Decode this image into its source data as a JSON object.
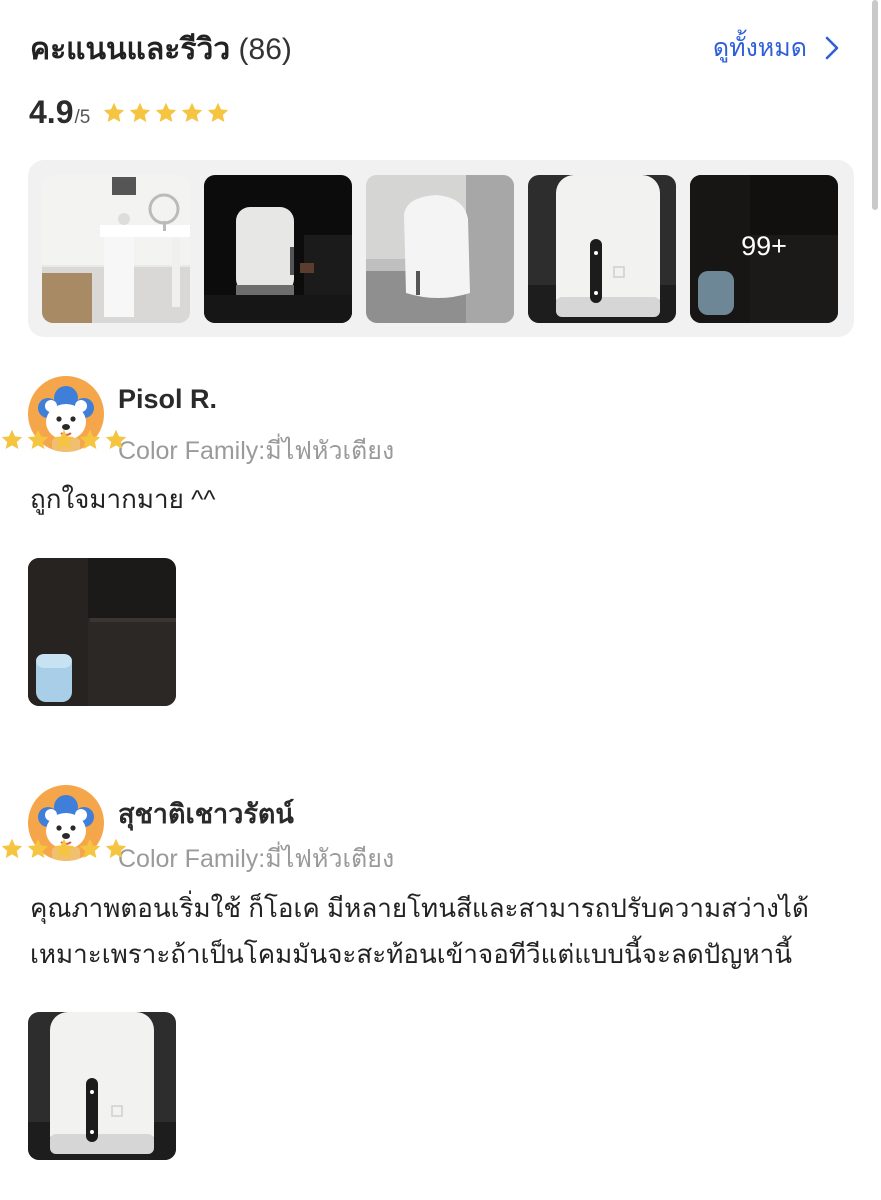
{
  "header": {
    "title": "คะแนนและรีวิว",
    "count": "(86)",
    "view_all_label": "ดูทั้งหมด"
  },
  "rating": {
    "value": "4.9",
    "max": "/5",
    "stars": 5
  },
  "gallery": {
    "more_label": "99+"
  },
  "reviews": [
    {
      "name": "Pisol R.",
      "variant": "Color Family:มี่ไฟหัวเตียง",
      "stars": 5,
      "text": "ถูกใจมากมาย ^^"
    },
    {
      "name": "สุชาติเชาวรัตน์",
      "variant": "Color Family:มี่ไฟหัวเตียง",
      "stars": 5,
      "text_line1": "คุณภาพตอนเริ่มใช้ ก็โอเค มีหลายโทนสีและสามารถปรับความสว่างได้",
      "text_line2": "เหมาะเพราะถ้าเป็นโคมมันจะสะท้อนเข้าจอทีวีแต่แบบนี้จะลดปัญหานี้"
    }
  ],
  "colors": {
    "link_blue": "#2f5fd8",
    "star_yellow": "#f5c542",
    "muted_gray": "#9a9a9a",
    "avatar_orange": "#f6a64a"
  }
}
